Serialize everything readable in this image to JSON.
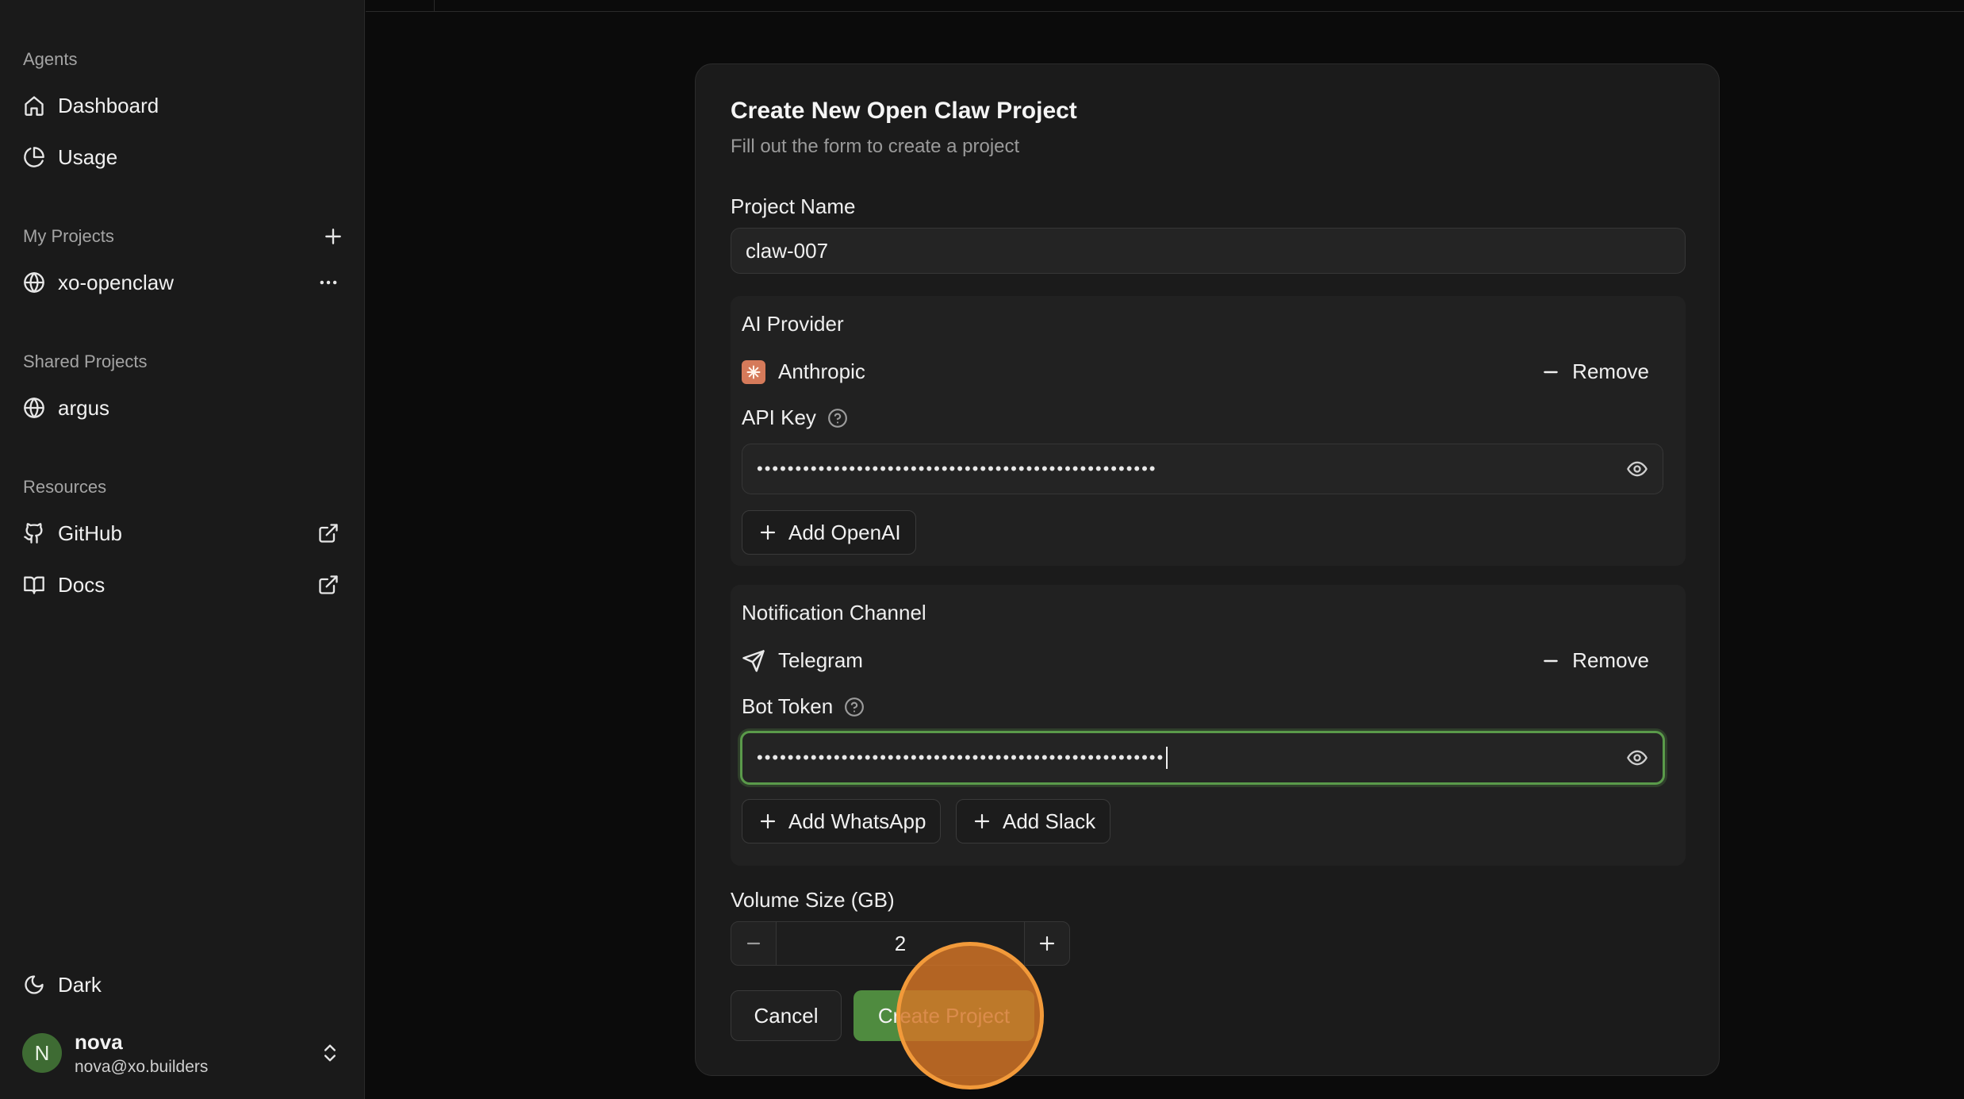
{
  "sidebar": {
    "agents_label": "Agents",
    "dashboard": "Dashboard",
    "usage": "Usage",
    "my_projects_label": "My Projects",
    "my_projects": [
      {
        "name": "xo-openclaw"
      }
    ],
    "shared_projects_label": "Shared Projects",
    "shared_projects": [
      {
        "name": "argus"
      }
    ],
    "resources_label": "Resources",
    "github": "GitHub",
    "docs": "Docs",
    "theme": "Dark",
    "user": {
      "initial": "N",
      "name": "nova",
      "email": "nova@xo.builders"
    }
  },
  "form": {
    "title": "Create New Open Claw Project",
    "subtitle": "Fill out the form to create a project",
    "project_name_label": "Project Name",
    "project_name_value": "claw-007",
    "ai_provider": {
      "label": "AI Provider",
      "provider": "Anthropic",
      "remove": "Remove",
      "api_key_label": "API Key",
      "api_key_masked": "••••••••••••••••••••••••••••••••••••••••••••••••••••",
      "add_button": "Add OpenAI"
    },
    "notification": {
      "label": "Notification Channel",
      "channel": "Telegram",
      "remove": "Remove",
      "token_label": "Bot Token",
      "token_masked": "•••••••••••••••••••••••••••••••••••••••••••••••••••••",
      "add_whatsapp": "Add WhatsApp",
      "add_slack": "Add Slack"
    },
    "volume_label": "Volume Size (GB)",
    "volume_value": "2",
    "cancel": "Cancel",
    "create": "Create Project"
  },
  "colors": {
    "accent_green": "#4f8b3f",
    "focus_ring": "#5a9a4a",
    "click_marker": "#f29a3a",
    "avatar_bg": "#3e6b33"
  },
  "icons": [
    "home-icon",
    "pie-chart-icon",
    "plus-icon",
    "globe-icon",
    "more-horizontal-icon",
    "github-icon",
    "external-link-icon",
    "book-icon",
    "moon-icon",
    "chevrons-up-down-icon",
    "minus-icon",
    "help-circle-icon",
    "eye-icon",
    "send-icon",
    "anthropic-logo-icon"
  ]
}
